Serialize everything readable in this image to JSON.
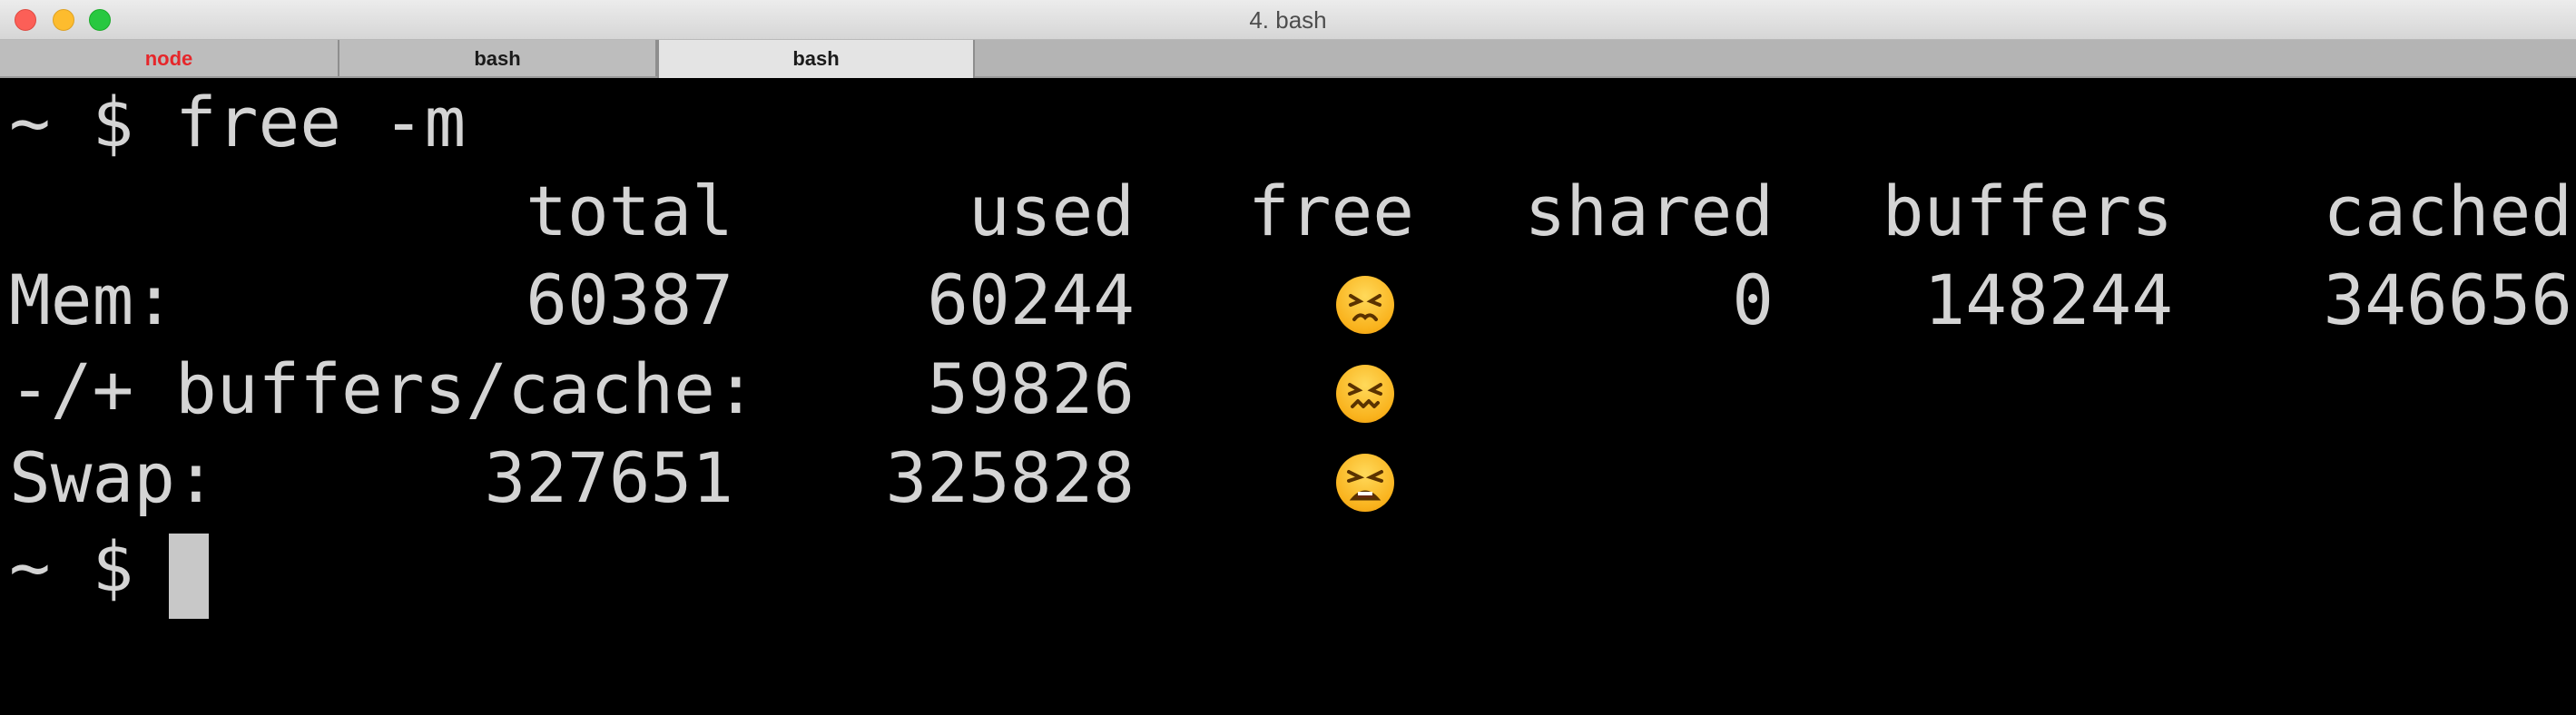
{
  "window": {
    "title": "4. bash"
  },
  "tabs": [
    {
      "label": "node",
      "active": false,
      "color": "#e6262a"
    },
    {
      "label": "bash",
      "active": false
    },
    {
      "label": "bash",
      "active": true
    }
  ],
  "terminal": {
    "prompt1": "~ $ free -m",
    "headers": {
      "total": "total",
      "used": "used",
      "free": "free",
      "shared": "shared",
      "buffers": "buffers",
      "cached": "cached"
    },
    "mem": {
      "label": "Mem:",
      "total": "60387",
      "used": "60244",
      "free_icon": "persevering-face-icon",
      "shared": "0",
      "buffers": "148244",
      "cached": "346656"
    },
    "bufcache": {
      "label": "-/+ buffers/cache:",
      "used": "59826",
      "free_icon": "confounded-face-icon"
    },
    "swap": {
      "label": "Swap:",
      "total": "327651",
      "used": "325828",
      "free_icon": "tired-face-icon"
    },
    "prompt2": "~ $ "
  },
  "colors": {
    "background": "#000000",
    "text": "#d4d4d4",
    "cursor": "#c8c8c8"
  }
}
